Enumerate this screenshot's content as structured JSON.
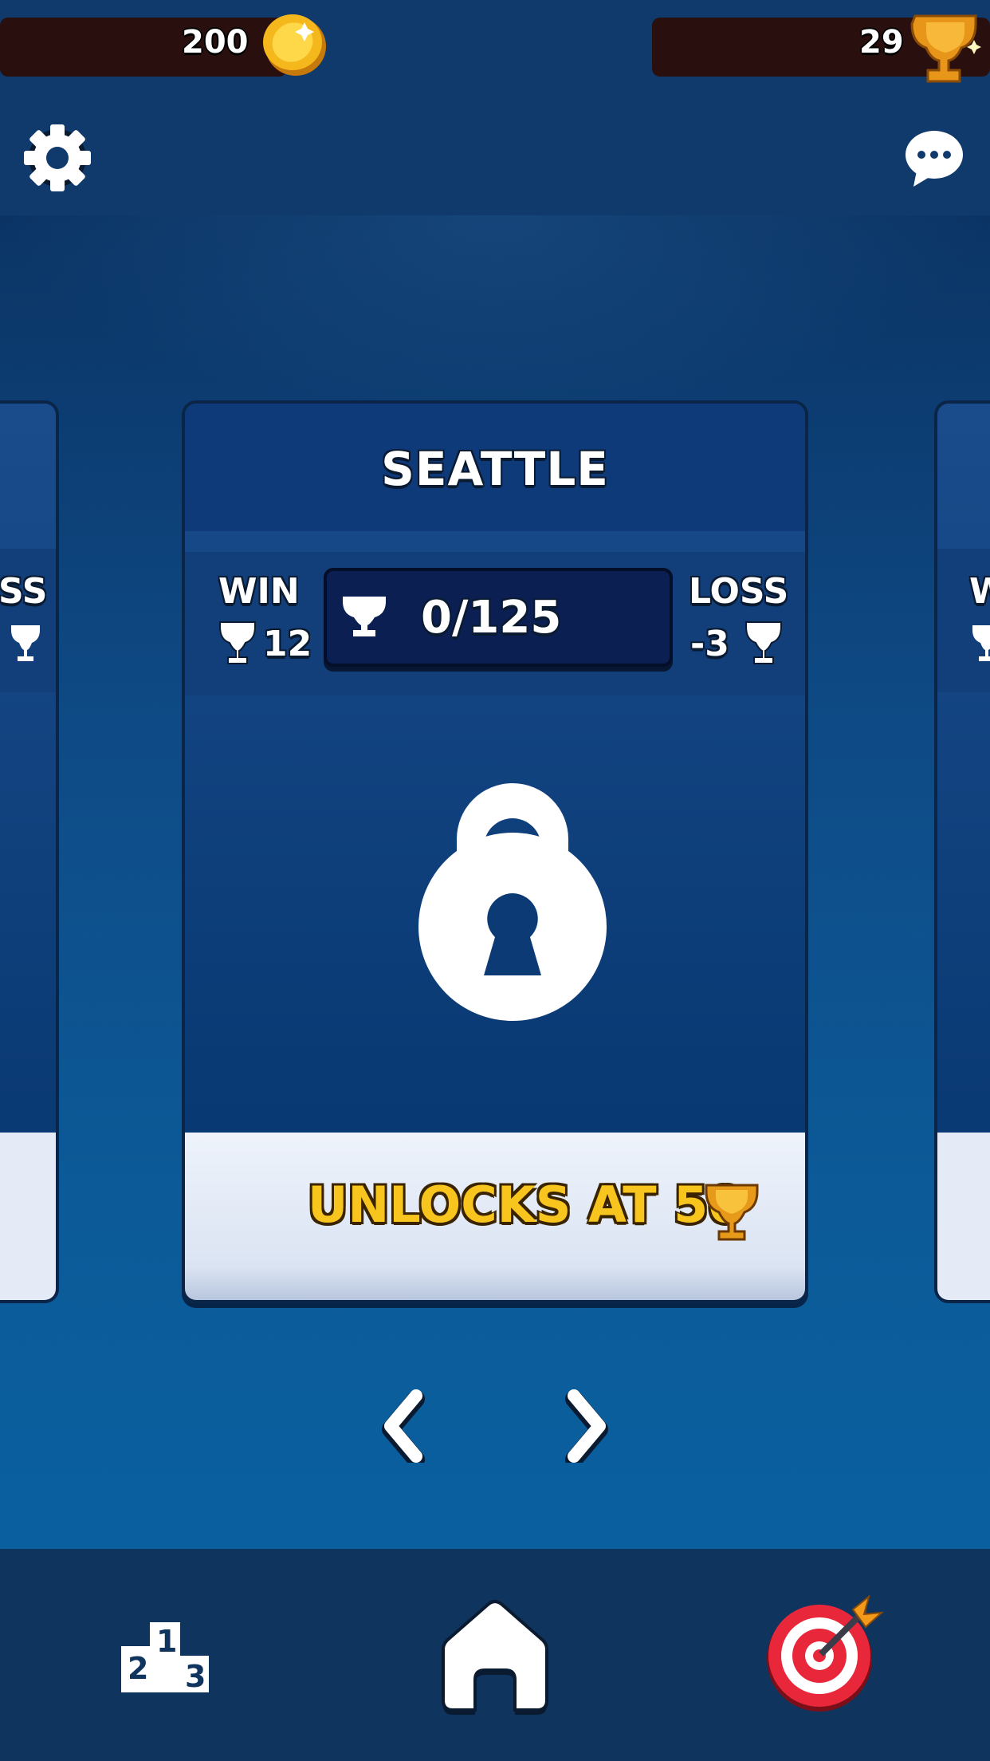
{
  "topbar": {
    "coins": "200",
    "trophies": "29"
  },
  "card": {
    "city": "SEATTLE",
    "win_label": "WIN",
    "win_value": "12",
    "loss_label": "LOSS",
    "loss_value": "-3",
    "progress": "0/125",
    "unlock_text": "UNLOCKS AT 50"
  },
  "side_cards": {
    "left_loss_fragment": "SS",
    "right_win_fragment": "W"
  },
  "icons": {
    "settings": "gear-icon",
    "chat": "speech-bubble-icon",
    "coin": "coin-icon",
    "trophy": "trophy-icon",
    "lock": "padlock-icon",
    "prev": "chevron-left-icon",
    "next": "chevron-right-icon",
    "leaderboard": "podium-icon",
    "home": "home-icon",
    "target": "target-icon"
  },
  "podium_numbers": [
    "1",
    "2",
    "3"
  ],
  "colors": {
    "accent_gold": "#f7c51d",
    "background": "#0e4a85",
    "stat_pill": "#2a0f0f"
  }
}
